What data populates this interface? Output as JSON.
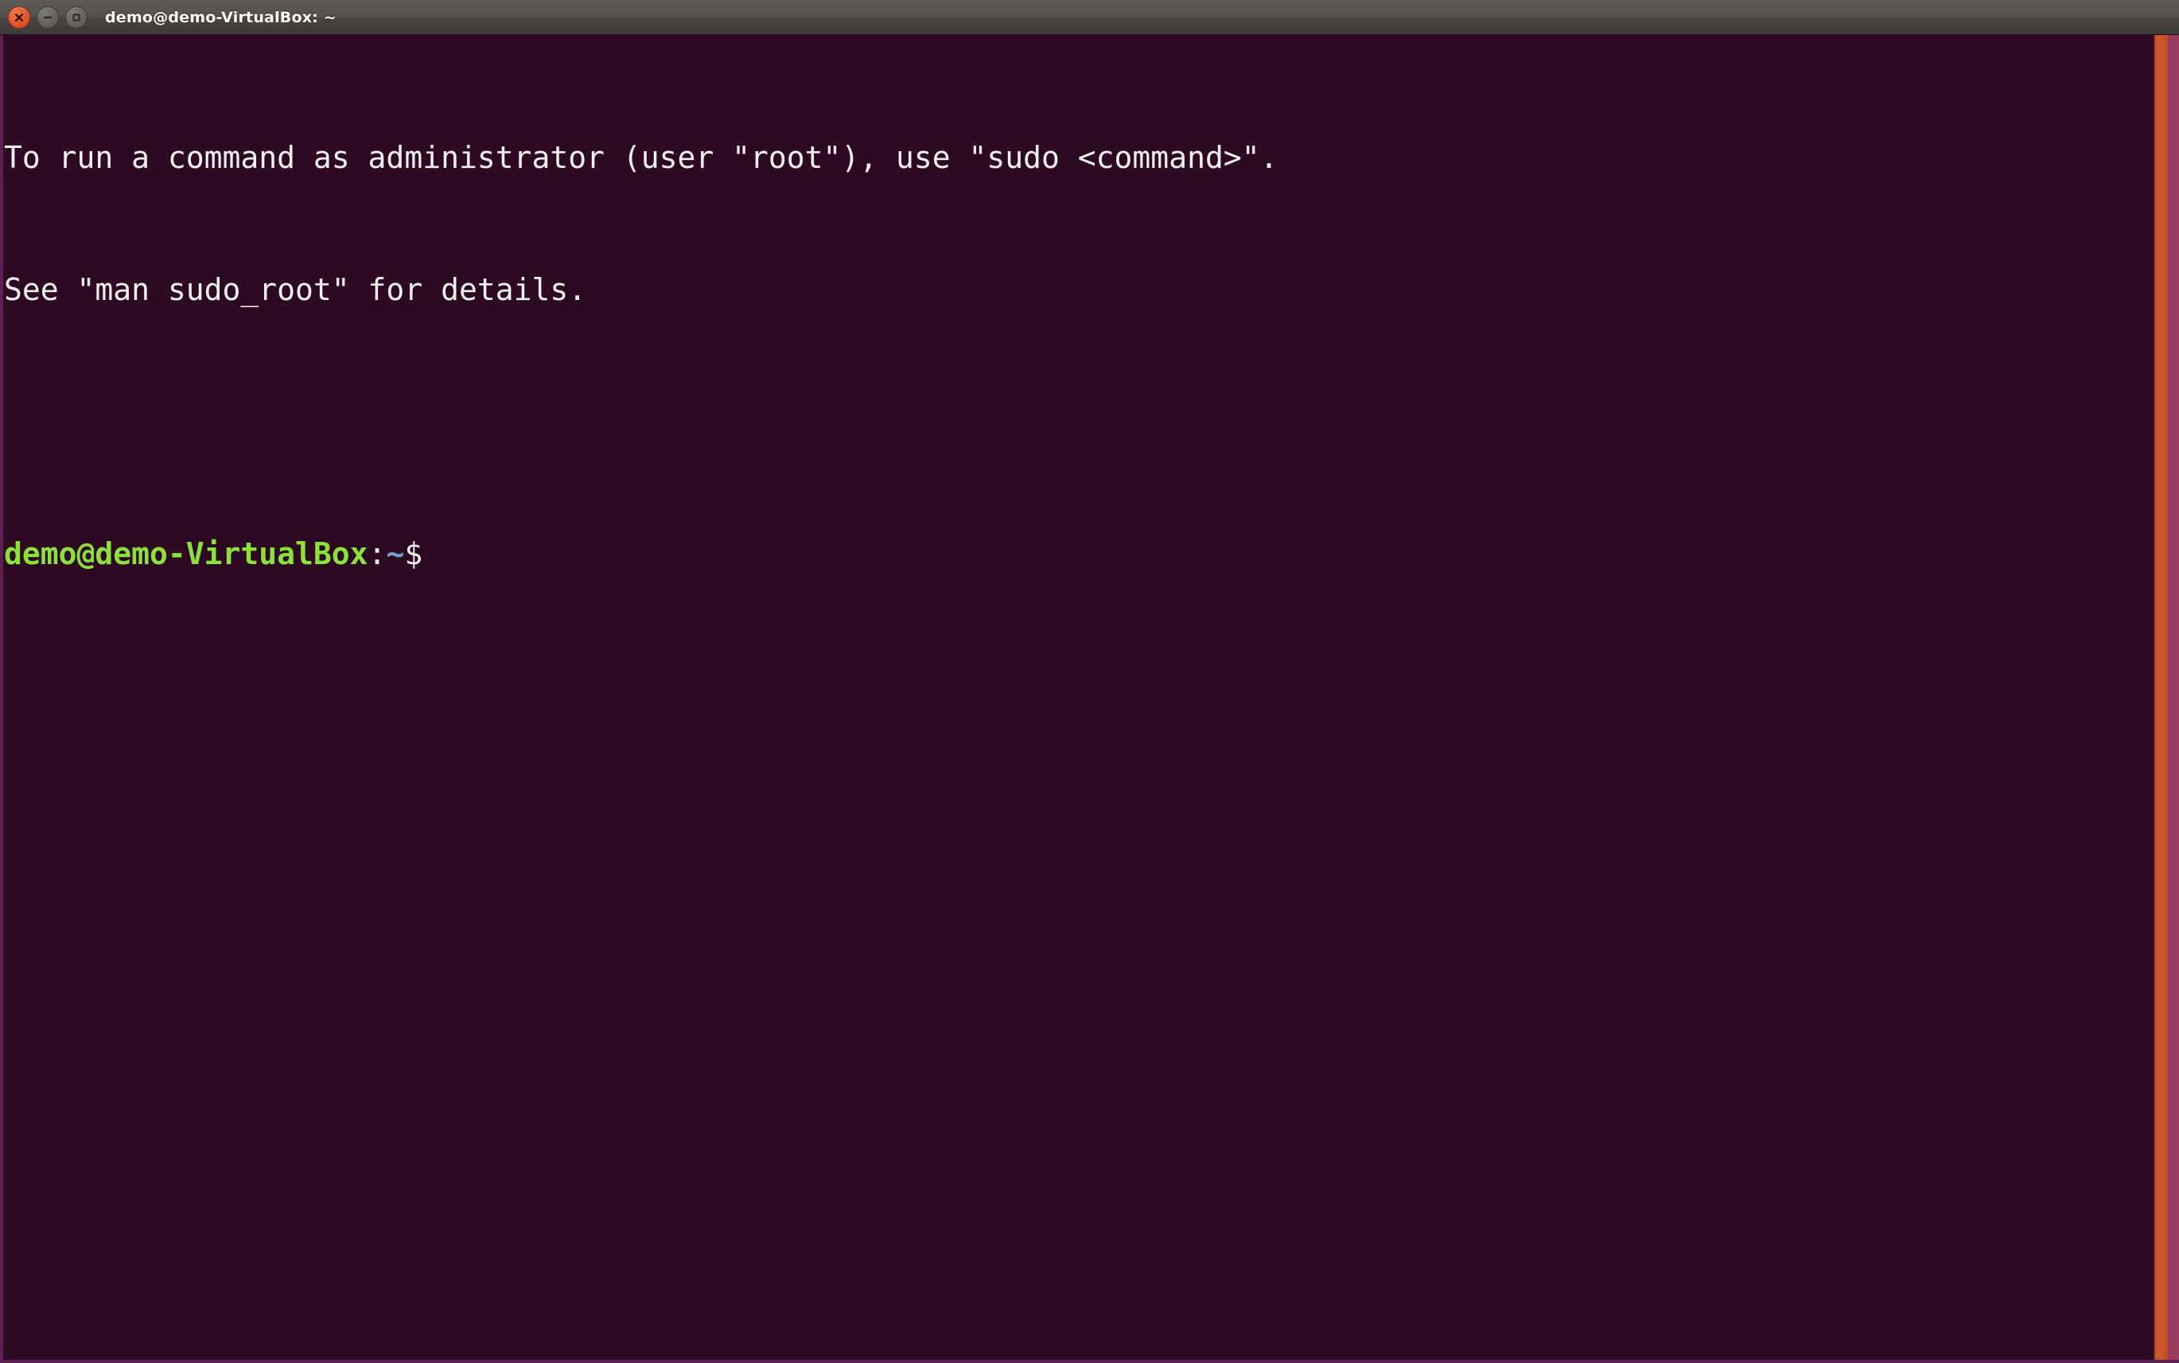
{
  "window": {
    "title": "demo@demo-VirtualBox: ~",
    "controls": [
      {
        "name": "close",
        "glyph": "×",
        "color": "#e2542a"
      },
      {
        "name": "minimize",
        "glyph": "−",
        "color": "#65625d"
      },
      {
        "name": "maximize",
        "glyph": "□",
        "color": "#65625d"
      }
    ]
  },
  "terminal": {
    "background_color": "#2d0922",
    "foreground_color": "#f2f0ec",
    "border_color": "#5c2150",
    "lines": [
      "To run a command as administrator (user \"root\"), use \"sudo <command>\".",
      "See \"man sudo_root\" for details."
    ],
    "prompt": {
      "user_host": "demo@demo-VirtualBox",
      "separator": ":",
      "path": "~",
      "symbol": "$",
      "user_host_color": "#8ae234",
      "path_color": "#729fcf",
      "symbol_color": "#f2f0ec"
    },
    "command_input": ""
  },
  "scrollbar": {
    "track_color": "#9b3c60",
    "thumb_color": "#d2572c",
    "position": "right"
  }
}
